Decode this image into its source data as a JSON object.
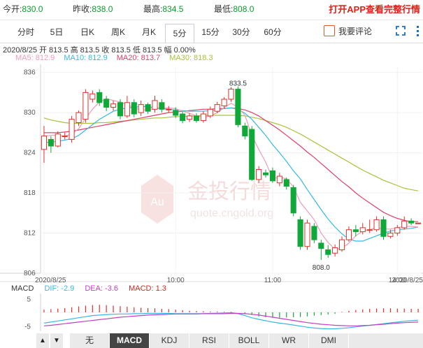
{
  "header": {
    "open_label": "今开:",
    "open_value": "830.0",
    "prev_label": "昨收:",
    "prev_value": "838.0",
    "high_label": "最高:",
    "high_value": "834.5",
    "low_label": "最低:",
    "low_value": "808.0",
    "promo": "打开APP查看完整行情"
  },
  "tabs": [
    "分时",
    "5日",
    "日K",
    "周K",
    "月K",
    "5分",
    "15分",
    "30分",
    "60分"
  ],
  "active_tab": "5分",
  "comment_label": "我要评论",
  "info_line": "2020/8/25 开 813.5 高 813.5 收 813.5 低 813.5 幅 0.00%",
  "ma": {
    "ma5": "MA5: 812.9",
    "ma10": "MA10: 812.9",
    "ma20": "MA20: 813.7",
    "ma30": "MA30: 818.3",
    "colors": {
      "ma5": "#f09cb6",
      "ma10": "#35b9e3",
      "ma20": "#e0406a",
      "ma30": "#a8c23a"
    }
  },
  "watermark": {
    "cn": "金投行情",
    "en": "quote.cngold.org",
    "badge": "Au"
  },
  "macd": {
    "label": "MACD",
    "dif": "DIF: -2.9",
    "dea": "DEA: -3.6",
    "macd": "MACD: 1.3"
  },
  "bottom_tabs": [
    "无",
    "MACD",
    "KDJ",
    "RSI",
    "BOLL",
    "WR",
    "DMI"
  ],
  "active_bottom_tab": "MACD",
  "arrows": [
    "▲",
    "▼"
  ],
  "chart_data": {
    "type": "candlestick",
    "y_ticks": [
      806,
      812,
      818,
      824,
      830,
      836
    ],
    "ylim": [
      806,
      836.8
    ],
    "x_labels": [
      {
        "i": 0,
        "label": "2020/8/25"
      },
      {
        "i": 19,
        "label": "10:00"
      },
      {
        "i": 33,
        "label": "11:00"
      },
      {
        "i": 51,
        "label": "14:00"
      },
      {
        "i": 70,
        "label": "2020/8/25"
      }
    ],
    "candles": [
      {
        "o": 824.5,
        "c": 826.5,
        "h": 828.0,
        "l": 822.5
      },
      {
        "o": 826.0,
        "c": 825.0,
        "h": 826.5,
        "l": 824.0
      },
      {
        "o": 825.0,
        "c": 826.8,
        "h": 827.2,
        "l": 824.8
      },
      {
        "o": 826.5,
        "c": 826.5,
        "h": 827.0,
        "l": 826.0
      },
      {
        "o": 826.0,
        "c": 829.0,
        "h": 829.5,
        "l": 825.5
      },
      {
        "o": 828.5,
        "c": 830.0,
        "h": 830.3,
        "l": 828.0
      },
      {
        "o": 829.0,
        "c": 833.0,
        "h": 833.5,
        "l": 828.5
      },
      {
        "o": 832.0,
        "c": 832.8,
        "h": 833.3,
        "l": 831.5
      },
      {
        "o": 833.0,
        "c": 831.5,
        "h": 833.5,
        "l": 831.0
      },
      {
        "o": 832.0,
        "c": 830.8,
        "h": 832.5,
        "l": 830.2
      },
      {
        "o": 830.8,
        "c": 831.3,
        "h": 831.8,
        "l": 830.3
      },
      {
        "o": 831.5,
        "c": 829.5,
        "h": 832.0,
        "l": 829.0
      },
      {
        "o": 829.5,
        "c": 831.5,
        "h": 832.5,
        "l": 829.2
      },
      {
        "o": 831.5,
        "c": 829.8,
        "h": 832.0,
        "l": 829.3
      },
      {
        "o": 830.0,
        "c": 831.2,
        "h": 831.8,
        "l": 829.5
      },
      {
        "o": 831.2,
        "c": 830.2,
        "h": 831.5,
        "l": 829.8
      },
      {
        "o": 830.5,
        "c": 831.8,
        "h": 832.5,
        "l": 830.0
      },
      {
        "o": 831.5,
        "c": 830.5,
        "h": 832.0,
        "l": 830.0
      },
      {
        "o": 830.5,
        "c": 830.5,
        "h": 831.0,
        "l": 830.0
      },
      {
        "o": 830.3,
        "c": 829.6,
        "h": 830.8,
        "l": 829.2
      },
      {
        "o": 829.8,
        "c": 828.8,
        "h": 830.2,
        "l": 828.4
      },
      {
        "o": 829.0,
        "c": 829.5,
        "h": 829.9,
        "l": 828.6
      },
      {
        "o": 829.5,
        "c": 828.8,
        "h": 829.9,
        "l": 828.5
      },
      {
        "o": 828.8,
        "c": 829.8,
        "h": 830.2,
        "l": 828.5
      },
      {
        "o": 829.5,
        "c": 830.5,
        "h": 830.9,
        "l": 829.2
      },
      {
        "o": 830.2,
        "c": 831.2,
        "h": 831.6,
        "l": 829.9
      },
      {
        "o": 831.0,
        "c": 832.0,
        "h": 832.3,
        "l": 830.6
      },
      {
        "o": 832.0,
        "c": 833.5,
        "h": 833.8,
        "l": 831.6
      },
      {
        "o": 833.5,
        "c": 828.2,
        "h": 833.9,
        "l": 827.8
      },
      {
        "o": 828.0,
        "c": 826.5,
        "h": 828.5,
        "l": 826.0
      },
      {
        "o": 827.5,
        "c": 820.0,
        "h": 828.0,
        "l": 819.8
      },
      {
        "o": 820.0,
        "c": 821.5,
        "h": 822.0,
        "l": 819.5
      },
      {
        "o": 821.0,
        "c": 820.7,
        "h": 821.5,
        "l": 820.3
      },
      {
        "o": 821.3,
        "c": 819.8,
        "h": 821.8,
        "l": 819.5
      },
      {
        "o": 819.5,
        "c": 820.5,
        "h": 821.0,
        "l": 819.0
      },
      {
        "o": 820.0,
        "c": 819.0,
        "h": 820.3,
        "l": 818.5
      },
      {
        "o": 818.8,
        "c": 815.0,
        "h": 819.2,
        "l": 814.5
      },
      {
        "o": 814.0,
        "c": 810.0,
        "h": 814.5,
        "l": 809.5
      },
      {
        "o": 810.0,
        "c": 813.5,
        "h": 814.0,
        "l": 809.5
      },
      {
        "o": 813.0,
        "c": 811.0,
        "h": 813.5,
        "l": 810.5
      },
      {
        "o": 810.5,
        "c": 809.7,
        "h": 811.0,
        "l": 808.0
      },
      {
        "o": 809.5,
        "c": 808.8,
        "h": 810.2,
        "l": 808.3
      },
      {
        "o": 809.0,
        "c": 809.8,
        "h": 810.3,
        "l": 808.5
      },
      {
        "o": 809.5,
        "c": 811.0,
        "h": 811.5,
        "l": 809.2
      },
      {
        "o": 811.0,
        "c": 812.5,
        "h": 813.0,
        "l": 810.7
      },
      {
        "o": 812.5,
        "c": 812.2,
        "h": 813.2,
        "l": 811.5
      },
      {
        "o": 812.2,
        "c": 812.8,
        "h": 813.5,
        "l": 811.8
      },
      {
        "o": 812.5,
        "c": 812.5,
        "h": 814.0,
        "l": 812.0
      },
      {
        "o": 812.5,
        "c": 814.0,
        "h": 814.5,
        "l": 812.2
      },
      {
        "o": 814.0,
        "c": 811.5,
        "h": 814.5,
        "l": 811.0
      },
      {
        "o": 811.5,
        "c": 812.0,
        "h": 812.5,
        "l": 811.2
      },
      {
        "o": 812.0,
        "c": 812.8,
        "h": 813.2,
        "l": 811.6
      },
      {
        "o": 812.8,
        "c": 813.8,
        "h": 814.5,
        "l": 812.5
      },
      {
        "o": 813.8,
        "c": 813.5,
        "h": 814.2,
        "l": 813.2
      },
      {
        "o": 813.5,
        "c": 813.5,
        "h": 813.5,
        "l": 813.5
      }
    ],
    "ma_series": {
      "ma5": [
        826.5,
        826.6,
        826.6,
        826.5,
        826.8,
        827.6,
        829.1,
        830.5,
        831.6,
        832.1,
        831.8,
        831.6,
        831.2,
        830.7,
        830.4,
        830.4,
        830.6,
        830.6,
        830.7,
        830.6,
        830.2,
        829.9,
        829.5,
        829.3,
        829.5,
        830.0,
        830.7,
        831.4,
        830.8,
        829.6,
        826.6,
        824.5,
        822.6,
        820.1,
        820.4,
        820.1,
        818.9,
        816.6,
        815.3,
        814.0,
        812.0,
        810.6,
        809.6,
        809.7,
        810.5,
        811.6,
        812.3,
        812.5,
        812.8,
        812.6,
        812.6,
        812.8,
        813.0,
        813.0,
        812.9
      ],
      "ma10": [
        825.5,
        825.6,
        825.7,
        825.9,
        826.1,
        826.6,
        827.4,
        828.2,
        829.0,
        829.6,
        830.2,
        830.5,
        830.7,
        830.8,
        830.9,
        830.9,
        830.7,
        830.6,
        830.5,
        830.4,
        830.3,
        830.2,
        830.2,
        830.2,
        830.3,
        830.4,
        830.6,
        830.7,
        830.5,
        829.9,
        829.0,
        827.8,
        826.6,
        825.2,
        824.0,
        822.7,
        821.3,
        820.1,
        818.5,
        817.0,
        815.5,
        814.1,
        812.9,
        811.9,
        811.1,
        810.8,
        810.8,
        811.2,
        811.6,
        812.0,
        812.3,
        812.5,
        812.6,
        812.7,
        812.9
      ],
      "ma20": [
        827.0,
        827.0,
        827.0,
        827.1,
        827.2,
        827.4,
        827.6,
        827.8,
        828.0,
        828.2,
        828.4,
        828.6,
        828.8,
        829.0,
        829.2,
        829.4,
        829.6,
        829.8,
        830.0,
        830.1,
        830.2,
        830.3,
        830.4,
        830.5,
        830.5,
        830.6,
        830.6,
        830.7,
        830.6,
        830.4,
        830.0,
        829.5,
        828.8,
        828.1,
        827.4,
        826.6,
        825.8,
        825.0,
        824.1,
        823.3,
        822.4,
        821.5,
        820.6,
        819.7,
        818.9,
        818.0,
        817.2,
        816.5,
        815.8,
        815.1,
        814.6,
        814.2,
        813.9,
        813.7,
        813.7
      ],
      "ma30": [
        829.2,
        828.9,
        828.7,
        828.5,
        828.4,
        828.4,
        828.4,
        828.4,
        828.5,
        828.5,
        828.6,
        828.7,
        828.8,
        828.9,
        829.0,
        829.1,
        829.2,
        829.2,
        829.3,
        829.4,
        829.4,
        829.5,
        829.5,
        829.6,
        829.6,
        829.6,
        829.6,
        829.6,
        829.6,
        829.5,
        829.3,
        829.1,
        828.8,
        828.5,
        828.2,
        827.8,
        827.3,
        826.8,
        826.2,
        825.6,
        825.0,
        824.4,
        823.8,
        823.2,
        822.6,
        822.0,
        821.4,
        820.9,
        820.4,
        819.9,
        819.5,
        819.1,
        818.7,
        818.5,
        818.3
      ]
    },
    "annotations": [
      {
        "i": 28,
        "value": 833.5,
        "text": "833.5",
        "pos": "above"
      },
      {
        "i": 40,
        "value": 808.0,
        "text": "808.0",
        "pos": "below"
      }
    ],
    "macd_ticks": [
      5,
      -5
    ],
    "macd_ylim": [
      -7,
      7
    ],
    "macd_hist": [
      1.0,
      1.2,
      1.4,
      1.6,
      1.9,
      2.2,
      2.5,
      2.7,
      2.8,
      2.7,
      2.5,
      2.3,
      2.1,
      1.9,
      1.7,
      1.6,
      1.5,
      1.3,
      1.2,
      1.0,
      0.8,
      0.6,
      0.5,
      0.4,
      0.3,
      0.3,
      0.2,
      0.2,
      0.0,
      -0.4,
      -1.0,
      -1.5,
      -1.8,
      -2.0,
      -2.0,
      -1.9,
      -1.8,
      -1.7,
      -1.5,
      -1.2,
      -1.0,
      -0.8,
      -0.5,
      0.2,
      0.6,
      0.9,
      1.1,
      1.3,
      1.4,
      1.5,
      1.5,
      1.4,
      1.4,
      1.3,
      1.3
    ],
    "macd_dif": [
      -4.0,
      -3.6,
      -3.2,
      -2.8,
      -2.4,
      -2.0,
      -1.6,
      -1.2,
      -1.0,
      -0.8,
      -0.7,
      -0.6,
      -0.6,
      -0.5,
      -0.5,
      -0.4,
      -0.4,
      -0.4,
      -0.4,
      -0.5,
      -0.5,
      -0.5,
      -0.5,
      -0.5,
      -0.4,
      -0.3,
      -0.2,
      -0.1,
      -0.5,
      -1.2,
      -2.0,
      -2.6,
      -3.1,
      -3.6,
      -4.0,
      -4.3,
      -4.7,
      -5.1,
      -5.5,
      -5.8,
      -6.0,
      -6.1,
      -6.1,
      -5.9,
      -5.7,
      -5.4,
      -5.1,
      -4.8,
      -4.5,
      -4.2,
      -3.9,
      -3.6,
      -3.3,
      -3.1,
      -2.9
    ],
    "macd_dea": [
      -5.0,
      -4.8,
      -4.5,
      -4.2,
      -3.9,
      -3.6,
      -3.3,
      -3.0,
      -2.7,
      -2.4,
      -2.1,
      -1.8,
      -1.6,
      -1.4,
      -1.2,
      -1.0,
      -0.9,
      -0.8,
      -0.7,
      -0.6,
      -0.6,
      -0.6,
      -0.6,
      -0.5,
      -0.5,
      -0.5,
      -0.5,
      -0.4,
      -0.4,
      -0.5,
      -0.7,
      -1.0,
      -1.4,
      -1.8,
      -2.2,
      -2.6,
      -3.0,
      -3.4,
      -3.8,
      -4.1,
      -4.4,
      -4.6,
      -4.8,
      -4.9,
      -5.0,
      -5.0,
      -4.9,
      -4.8,
      -4.6,
      -4.4,
      -4.2,
      -4.0,
      -3.8,
      -3.7,
      -3.6
    ]
  }
}
